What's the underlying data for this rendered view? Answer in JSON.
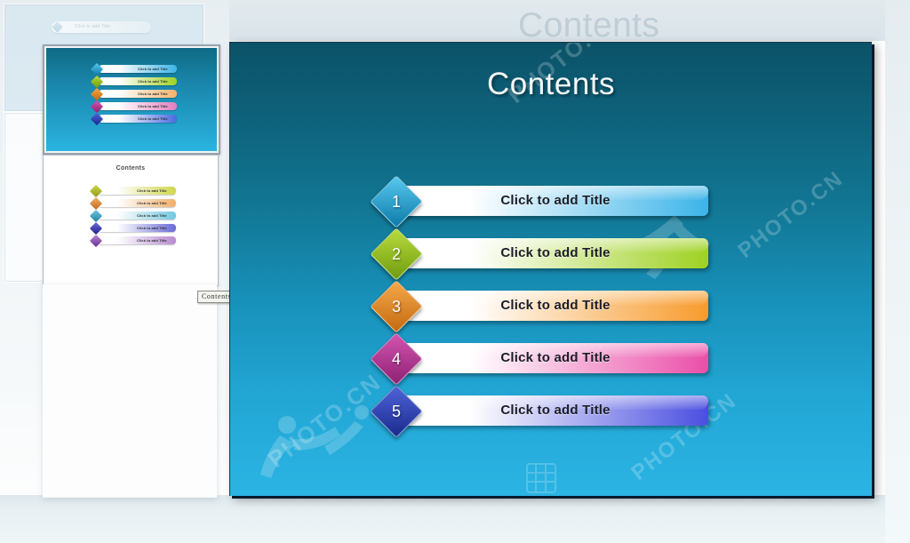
{
  "ghost": {
    "title": "Contents",
    "bar_label": "Click to add Title"
  },
  "tooltip": {
    "label": "Contents"
  },
  "slide": {
    "title": "Contents",
    "bg_top_color": "#0b5268",
    "bg_bottom_color": "#2bb4e4",
    "watermarks": [
      "PHOTO.CN",
      "PHOTO.CN",
      "PHOTO.CN",
      "PHOTO.CN"
    ],
    "rows": [
      {
        "number": "1",
        "label": "Click to add Title",
        "bar_start": "#ffffff",
        "bar_end": "#3cb4e8",
        "dia_start": "#57c8ef",
        "dia_end": "#0d7aa8"
      },
      {
        "number": "2",
        "label": "Click to add Title",
        "bar_start": "#ffffff",
        "bar_end": "#9fd122",
        "dia_start": "#b9dc3c",
        "dia_end": "#6f9b10"
      },
      {
        "number": "3",
        "label": "Click to add Title",
        "bar_start": "#ffffff",
        "bar_end": "#f79b2c",
        "dia_start": "#f5a84a",
        "dia_end": "#c46a10"
      },
      {
        "number": "4",
        "label": "Click to add Title",
        "bar_start": "#ffffff",
        "bar_end": "#ea4fa8",
        "dia_start": "#d354b0",
        "dia_end": "#8e2172"
      },
      {
        "number": "5",
        "label": "Click to add Title",
        "bar_start": "#ffffff",
        "bar_end": "#4a4ee0",
        "dia_start": "#4e63d8",
        "dia_end": "#1a2a8c"
      }
    ]
  },
  "thumbnails": [
    {
      "selected": true,
      "title": "",
      "rows": [
        {
          "label": "Click to add Title",
          "bar_start": "#ffffff",
          "bar_end": "#3cb4e8",
          "dia_start": "#57c8ef",
          "dia_end": "#0d7aa8"
        },
        {
          "label": "Click to add Title",
          "bar_start": "#ffffff",
          "bar_end": "#9fd122",
          "dia_start": "#b9dc3c",
          "dia_end": "#6f9b10"
        },
        {
          "label": "Click to add Title",
          "bar_start": "#ffffff",
          "bar_end": "#f5b36a",
          "dia_start": "#f5a84a",
          "dia_end": "#c46a10"
        },
        {
          "label": "Click to add Title",
          "bar_start": "#ffffff",
          "bar_end": "#e07ec0",
          "dia_start": "#d354b0",
          "dia_end": "#8e2172"
        },
        {
          "label": "Click to add Title",
          "bar_start": "#ffffff",
          "bar_end": "#4a6ae0",
          "dia_start": "#4e63d8",
          "dia_end": "#1a2a8c"
        }
      ]
    },
    {
      "selected": false,
      "title": "Contents",
      "rows": [
        {
          "label": "Click to add Title",
          "bar_start": "#ffffff",
          "bar_end": "#cfd84a",
          "dia_start": "#cfd84a",
          "dia_end": "#8f9a18"
        },
        {
          "label": "Click to add Title",
          "bar_start": "#ffffff",
          "bar_end": "#f0b06a",
          "dia_start": "#f0b06a",
          "dia_end": "#c06a18"
        },
        {
          "label": "Click to add Title",
          "bar_start": "#ffffff",
          "bar_end": "#72c8e0",
          "dia_start": "#72c8e0",
          "dia_end": "#1d7fa4"
        },
        {
          "label": "Click to add Title",
          "bar_start": "#ffffff",
          "bar_end": "#6a6ad8",
          "dia_start": "#6a6ad8",
          "dia_end": "#22228c"
        },
        {
          "label": "Click to add Title",
          "bar_start": "#ffffff",
          "bar_end": "#b98ad0",
          "dia_start": "#b98ad0",
          "dia_end": "#6a2a96"
        }
      ]
    }
  ]
}
